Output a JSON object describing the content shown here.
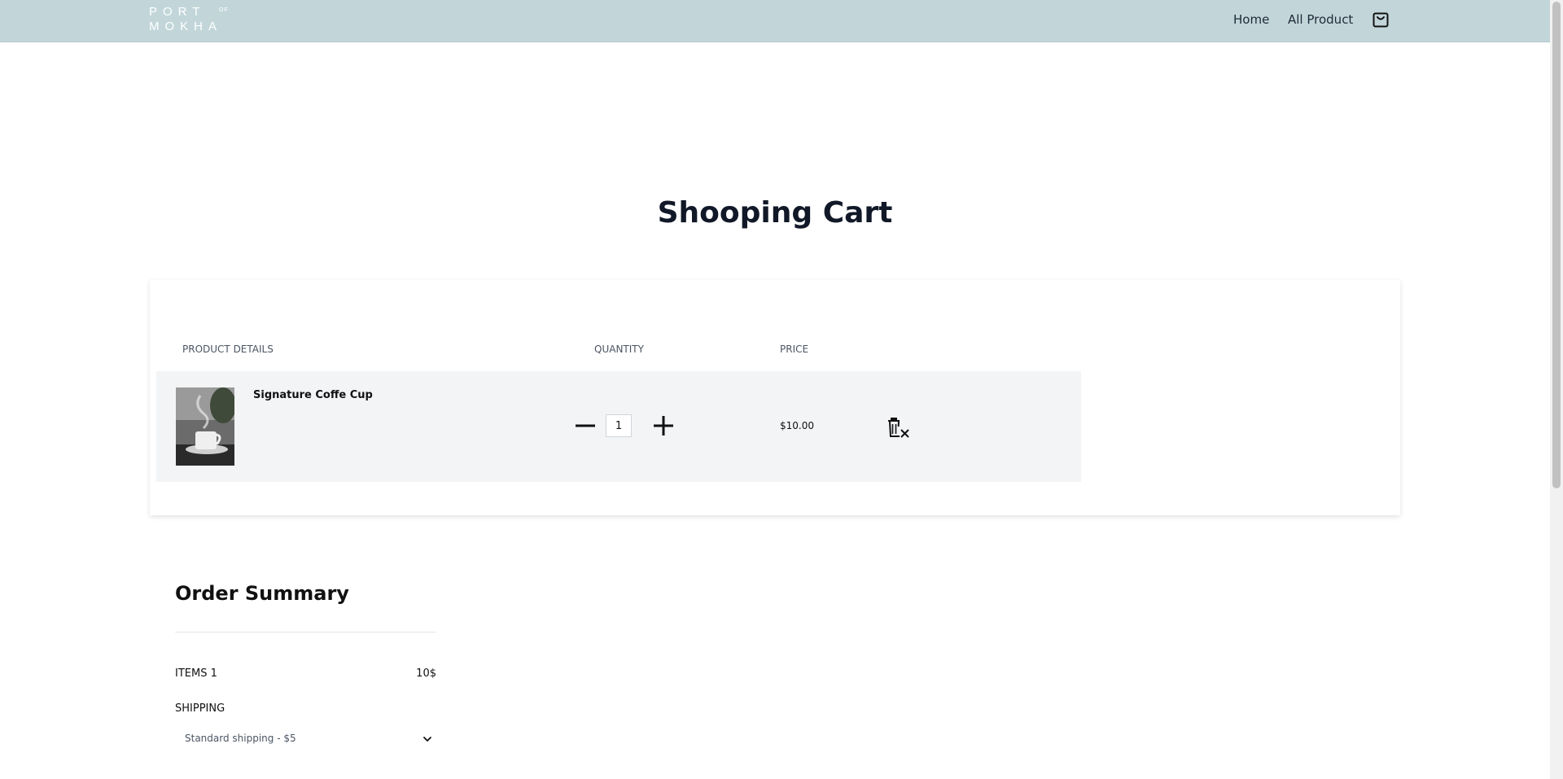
{
  "header": {
    "logo": {
      "line1": "PORT",
      "of": "OF",
      "line2": "MOKHA"
    },
    "nav": {
      "home": "Home",
      "all_product": "All Product"
    },
    "cart_icon": "shopping-bag-icon"
  },
  "page": {
    "title": "Shooping Cart"
  },
  "cart": {
    "columns": {
      "product": "PRODUCT DETAILS",
      "quantity": "QUANTITY",
      "price": "PRICE"
    },
    "items": [
      {
        "name": "Signature Coffe Cup",
        "quantity": "1",
        "price": "$10.00",
        "thumbnail_icon": "coffee-cup-photo"
      }
    ],
    "icons": {
      "minus": "minus-icon",
      "plus": "plus-icon",
      "remove": "trash-x-icon"
    }
  },
  "summary": {
    "title": "Order Summary",
    "items_label": "ITEMS 1",
    "items_value": "10$",
    "shipping_label": "SHIPPING",
    "shipping_selected": "Standard shipping - $5"
  },
  "colors": {
    "header_bg": "#c2d6da",
    "row_bg": "#f3f4f6",
    "title": "#111827"
  }
}
